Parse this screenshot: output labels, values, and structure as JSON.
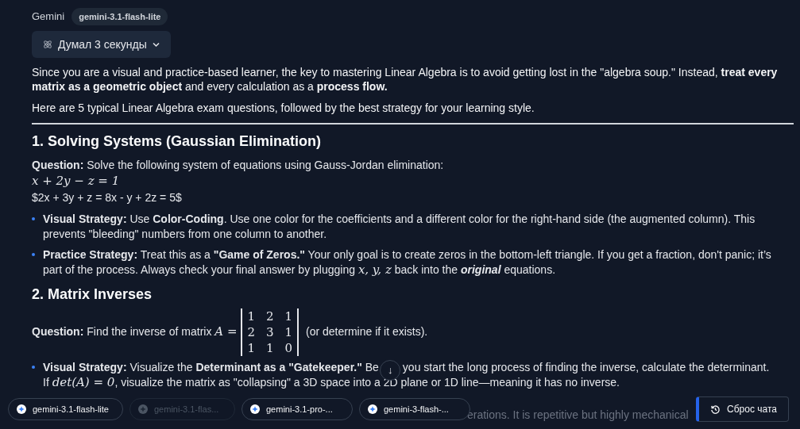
{
  "header": {
    "assistant": "Gemini",
    "model_badge": "gemini-3.1-flash-lite"
  },
  "thinking": {
    "label": "Думал 3 секунды",
    "expanded": false
  },
  "intro": [
    "Since you are a visual and practice-based learner, the key to mastering Linear Algebra is to avoid getting lost in the \"algebra soup.\" Instead, **treat every matrix as a geometric object** and every calculation as a **process flow.**",
    "Here are 5 typical Linear Algebra exam questions, followed by the best strategy for your learning style."
  ],
  "sections": [
    {
      "heading": "1. Solving Systems (Gaussian Elimination)",
      "question": [
        {
          "kind": "rich",
          "text": "**Question:** Solve the following system of equations using Gauss-Jordan elimination:"
        }
      ],
      "lines": [
        {
          "kind": "math",
          "text": "x + 2y − z = 1"
        },
        {
          "kind": "rich",
          "text": "$2x + 3y + z = 8x - y + 2z = 5$"
        }
      ],
      "bullets": [
        [
          {
            "kind": "rich",
            "text": "**Visual Strategy:** Use **Color-Coding**. Use one color for the coefficients and a different color for the right-hand side (the augmented column). This prevents \"bleeding\" numbers from one column to another."
          }
        ],
        [
          {
            "kind": "rich",
            "text": "**Practice Strategy:** Treat this as a **\"Game of Zeros.\"** Your only goal is to create zeros in the bottom-left triangle. If you get a fraction, don't panic; it’s part of the process. Always check your final answer by plugging "
          },
          {
            "kind": "math",
            "text": "x, y, z"
          },
          {
            "kind": "rich",
            "text": " back into the "
          },
          {
            "kind": "emph",
            "text": "original"
          },
          {
            "kind": "rich",
            "text": " equations."
          }
        ]
      ]
    },
    {
      "heading": "2. Matrix Inverses",
      "question": [
        {
          "kind": "rich",
          "text": "**Question:** Find the inverse of matrix "
        },
        {
          "kind": "math",
          "text": "A ="
        },
        {
          "kind": "matrix",
          "rows": [
            [
              "1",
              "2",
              "1"
            ],
            [
              "2",
              "3",
              "1"
            ],
            [
              "1",
              "1",
              "0"
            ]
          ]
        },
        {
          "kind": "rich",
          "text": " (or determine if it exists)."
        }
      ],
      "bullets": [
        [
          {
            "kind": "rich",
            "text": "**Visual Strategy:** Visualize the **Determinant as a \"Gatekeeper.\"** Be"
          },
          {
            "kind": "scroll_button",
            "text": "↓"
          },
          {
            "kind": "rich",
            "text": "you start the long process of finding the inverse, calculate the determinant."
          },
          {
            "kind": "break"
          },
          {
            "kind": "rich",
            "text": "If "
          },
          {
            "kind": "math",
            "text": "det(A) = 0"
          },
          {
            "kind": "rich",
            "text": ", visualize the matrix as \"collapsing\" a 3D space into a 2D plane or 1D line—meaning it has no inverse."
          }
        ]
      ]
    }
  ],
  "faded_fragments": [
    "erations. It is repetitive but highly mechanical"
  ],
  "model_chips": [
    {
      "label": "gemini-3.1-flash-lite",
      "disabled": false
    },
    {
      "label": "gemini-3.1-flas...",
      "disabled": true
    },
    {
      "label": "gemini-3.1-pro-...",
      "disabled": false
    },
    {
      "label": "gemini-3-flash-...",
      "disabled": false
    }
  ],
  "reset_button": "Сброс чата"
}
